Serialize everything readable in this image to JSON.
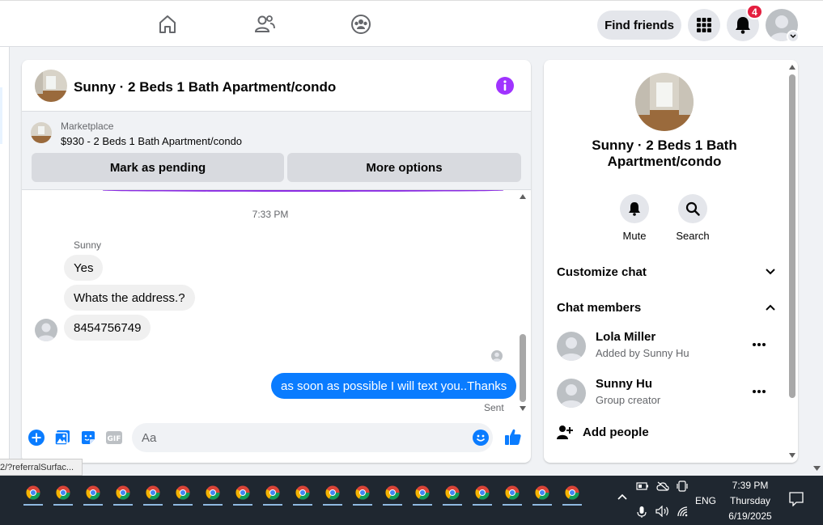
{
  "topnav": {
    "find_friends_label": "Find friends",
    "notification_count": "4"
  },
  "chat": {
    "title": "Sunny · 2 Beds 1 Bath Apartment/condo",
    "marketplace_label": "Marketplace",
    "listing_price_title": "$930 - 2 Beds 1 Bath Apartment/condo",
    "mark_pending_label": "Mark as pending",
    "more_options_label": "More options",
    "timestamp": "7:33 PM",
    "sender_name": "Sunny",
    "incoming_messages": [
      "Yes",
      "Whats the address.?",
      "8454756749"
    ],
    "outgoing_message": "as soon as possible I will text you..Thanks",
    "sent_status": "Sent",
    "composer_placeholder": "Aa"
  },
  "details": {
    "title": "Sunny · 2 Beds 1 Bath Apartment/condo",
    "mute_label": "Mute",
    "search_label": "Search",
    "customize_label": "Customize chat",
    "members_label": "Chat members",
    "members": [
      {
        "name": "Lola Miller",
        "subtitle": "Added by Sunny Hu"
      },
      {
        "name": "Sunny Hu",
        "subtitle": "Group creator"
      }
    ],
    "add_people_label": "Add people"
  },
  "status_url": "2/?referralSurfac...",
  "taskbar": {
    "language": "ENG",
    "time": "7:39 PM",
    "day": "Thursday",
    "date": "6/19/2025"
  },
  "colors": {
    "accent": "#0a7cff",
    "badge": "#e41e3f",
    "info": "#a033ff"
  }
}
